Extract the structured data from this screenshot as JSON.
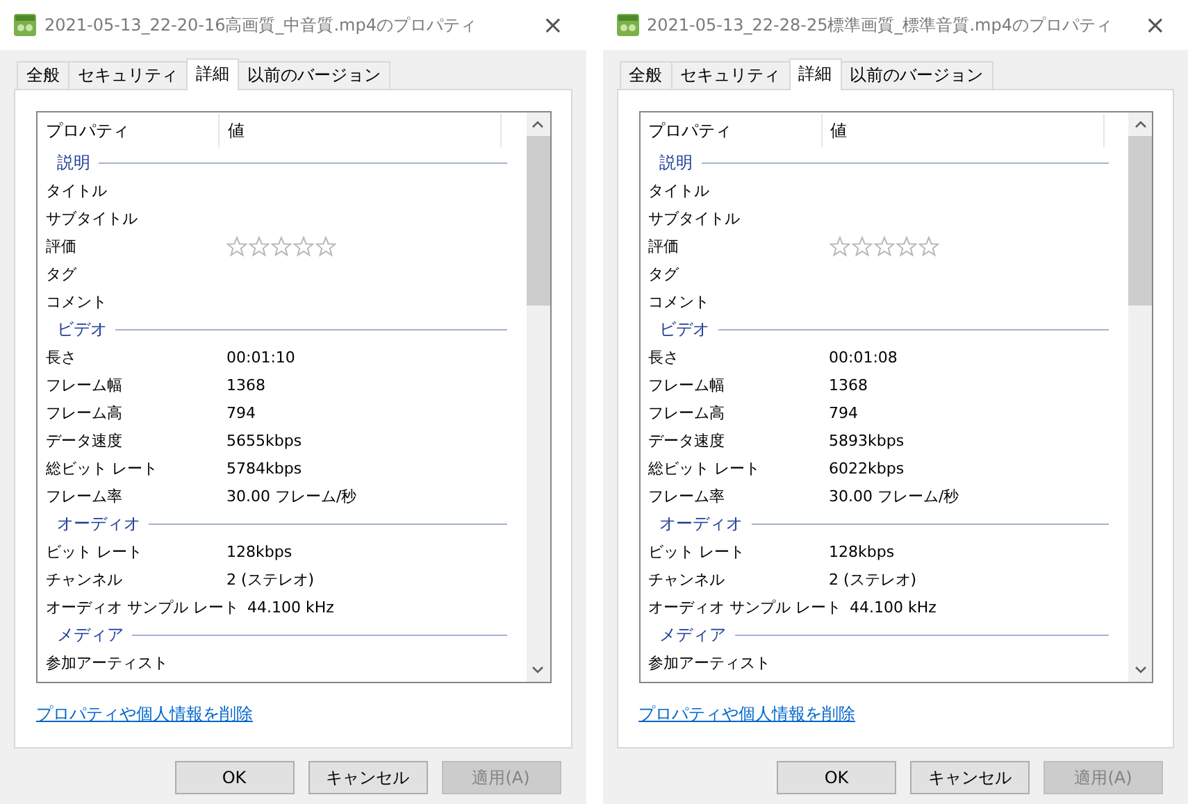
{
  "dialogs": [
    {
      "title": "2021-05-13_22-20-16高画質_中音質.mp4のプロパティ",
      "close": "×",
      "tabs": [
        {
          "label": "全般",
          "selected": false
        },
        {
          "label": "セキュリティ",
          "selected": false
        },
        {
          "label": "詳細",
          "selected": true
        },
        {
          "label": "以前のバージョン",
          "selected": false
        }
      ],
      "columns": [
        "プロパティ",
        "値"
      ],
      "groups": [
        {
          "label": "説明",
          "rows": [
            {
              "kind": "text",
              "name": "タイトル"
            },
            {
              "kind": "text",
              "name": "サブタイトル"
            },
            {
              "kind": "rating",
              "name": "評価",
              "stars": 0
            },
            {
              "kind": "text",
              "name": "タグ"
            },
            {
              "kind": "text",
              "name": "コメント"
            }
          ]
        },
        {
          "label": "ビデオ",
          "rows": [
            {
              "kind": "text",
              "name": "長さ",
              "value": "00:01:10"
            },
            {
              "kind": "text",
              "name": "フレーム幅",
              "value": "1368"
            },
            {
              "kind": "text",
              "name": "フレーム高",
              "value": "794"
            },
            {
              "kind": "text",
              "name": "データ速度",
              "value": "5655kbps"
            },
            {
              "kind": "text",
              "name": "総ビット レート",
              "value": "5784kbps"
            },
            {
              "kind": "text",
              "name": "フレーム率",
              "value": "30.00 フレーム/秒"
            }
          ]
        },
        {
          "label": "オーディオ",
          "rows": [
            {
              "kind": "text",
              "name": "ビット レート",
              "value": "128kbps"
            },
            {
              "kind": "text",
              "name": "チャンネル",
              "value": "2 (ステレオ)"
            },
            {
              "kind": "text",
              "name": "オーディオ サンプル レート",
              "value": "44.100 kHz"
            }
          ]
        },
        {
          "label": "メディア",
          "rows": [
            {
              "kind": "text",
              "name": "参加アーティスト"
            }
          ]
        }
      ],
      "link": "プロパティや個人情報を削除",
      "buttons": [
        {
          "label": "OK",
          "disabled": false
        },
        {
          "label": "キャンセル",
          "disabled": false
        },
        {
          "label": "適用(A)",
          "disabled": true
        }
      ]
    },
    {
      "title": "2021-05-13_22-28-25標準画質_標準音質.mp4のプロパティ",
      "close": "×",
      "tabs": [
        {
          "label": "全般",
          "selected": false
        },
        {
          "label": "セキュリティ",
          "selected": false
        },
        {
          "label": "詳細",
          "selected": true
        },
        {
          "label": "以前のバージョン",
          "selected": false
        }
      ],
      "columns": [
        "プロパティ",
        "値"
      ],
      "groups": [
        {
          "label": "説明",
          "rows": [
            {
              "kind": "text",
              "name": "タイトル"
            },
            {
              "kind": "text",
              "name": "サブタイトル"
            },
            {
              "kind": "rating",
              "name": "評価",
              "stars": 0
            },
            {
              "kind": "text",
              "name": "タグ"
            },
            {
              "kind": "text",
              "name": "コメント"
            }
          ]
        },
        {
          "label": "ビデオ",
          "rows": [
            {
              "kind": "text",
              "name": "長さ",
              "value": "00:01:08"
            },
            {
              "kind": "text",
              "name": "フレーム幅",
              "value": "1368"
            },
            {
              "kind": "text",
              "name": "フレーム高",
              "value": "794"
            },
            {
              "kind": "text",
              "name": "データ速度",
              "value": "5893kbps"
            },
            {
              "kind": "text",
              "name": "総ビット レート",
              "value": "6022kbps"
            },
            {
              "kind": "text",
              "name": "フレーム率",
              "value": "30.00 フレーム/秒"
            }
          ]
        },
        {
          "label": "オーディオ",
          "rows": [
            {
              "kind": "text",
              "name": "ビット レート",
              "value": "128kbps"
            },
            {
              "kind": "text",
              "name": "チャンネル",
              "value": "2 (ステレオ)"
            },
            {
              "kind": "text",
              "name": "オーディオ サンプル レート",
              "value": "44.100 kHz"
            }
          ]
        },
        {
          "label": "メディア",
          "rows": [
            {
              "kind": "text",
              "name": "参加アーティスト"
            }
          ]
        }
      ],
      "link": "プロパティや個人情報を削除",
      "buttons": [
        {
          "label": "OK",
          "disabled": false
        },
        {
          "label": "キャンセル",
          "disabled": false
        },
        {
          "label": "適用(A)",
          "disabled": true
        }
      ]
    }
  ]
}
